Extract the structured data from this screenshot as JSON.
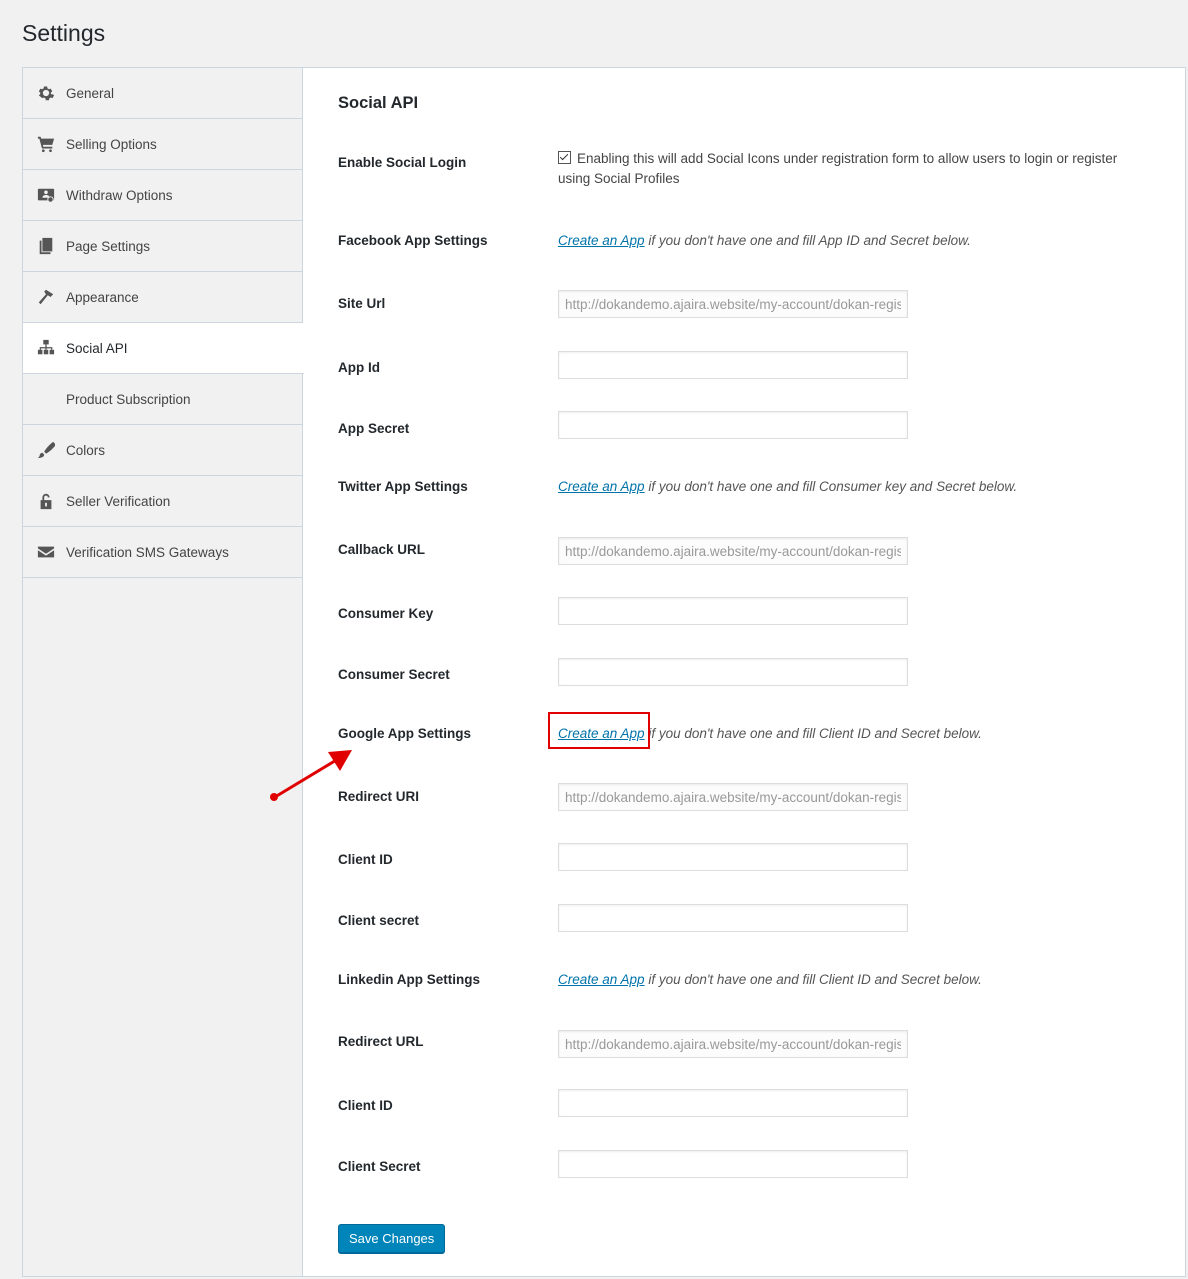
{
  "page": {
    "title": "Settings"
  },
  "sidebar": {
    "items": [
      {
        "label": "General",
        "icon": "gear-icon"
      },
      {
        "label": "Selling Options",
        "icon": "cart-icon"
      },
      {
        "label": "Withdraw Options",
        "icon": "withdraw-icon"
      },
      {
        "label": "Page Settings",
        "icon": "pages-icon"
      },
      {
        "label": "Appearance",
        "icon": "hammer-icon"
      },
      {
        "label": "Social API",
        "icon": "network-icon",
        "active": true
      },
      {
        "label": "Product Subscription",
        "icon": ""
      },
      {
        "label": "Colors",
        "icon": "brush-icon"
      },
      {
        "label": "Seller Verification",
        "icon": "lock-icon"
      },
      {
        "label": "Verification SMS Gateways",
        "icon": "envelope-icon"
      }
    ]
  },
  "main": {
    "section_title": "Social API",
    "enable_social_login": {
      "label": "Enable Social Login",
      "checked": true,
      "text_line1": "Enabling this will add Social Icons under registration form to allow users to login or register",
      "text_line2": "using Social Profiles"
    },
    "link_text": "Create an App",
    "facebook": {
      "heading": "Facebook App Settings",
      "desc": " if you don't have one and fill App ID and Secret below.",
      "site_url": {
        "label": "Site Url",
        "value": "http://dokandemo.ajaira.website/my-account/dokan-registration/"
      },
      "app_id": {
        "label": "App Id",
        "value": ""
      },
      "app_secret": {
        "label": "App Secret",
        "value": ""
      }
    },
    "twitter": {
      "heading": "Twitter App Settings",
      "desc": " if you don't have one and fill Consumer key and Secret below.",
      "callback_url": {
        "label": "Callback URL",
        "value": "http://dokandemo.ajaira.website/my-account/dokan-registration/"
      },
      "consumer_key": {
        "label": "Consumer Key",
        "value": ""
      },
      "consumer_secret": {
        "label": "Consumer Secret",
        "value": ""
      }
    },
    "google": {
      "heading": "Google App Settings",
      "desc": " if you don't have one and fill Client ID and Secret below.",
      "redirect_uri": {
        "label": "Redirect URI",
        "value": "http://dokandemo.ajaira.website/my-account/dokan-registration/"
      },
      "client_id": {
        "label": "Client ID",
        "value": ""
      },
      "client_secret": {
        "label": "Client secret",
        "value": ""
      }
    },
    "linkedin": {
      "heading": "Linkedin App Settings",
      "desc": " if you don't have one and fill Client ID and Secret below.",
      "redirect_url": {
        "label": "Redirect URL",
        "value": "http://dokandemo.ajaira.website/my-account/dokan-registration/"
      },
      "client_id": {
        "label": "Client ID",
        "value": ""
      },
      "client_secret": {
        "label": "Client Secret",
        "value": ""
      }
    },
    "save_label": "Save Changes"
  },
  "annotation": {
    "color": "#e00000"
  }
}
